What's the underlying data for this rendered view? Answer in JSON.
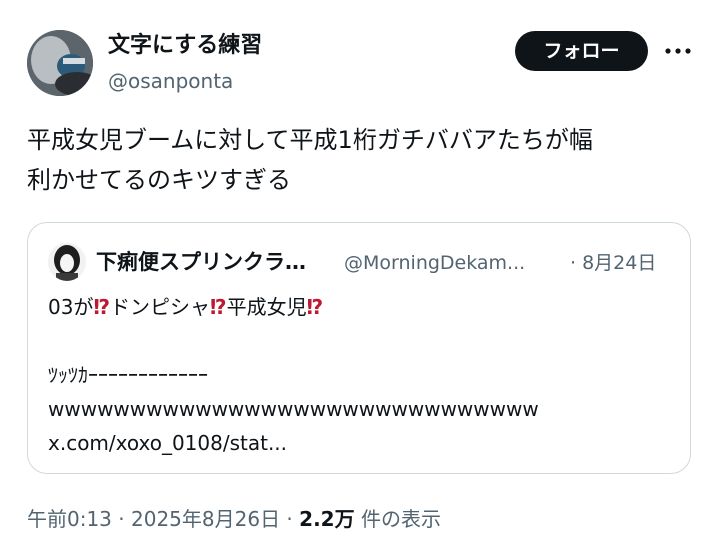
{
  "author": {
    "display_name": "文字にする練習",
    "handle": "@osanponta"
  },
  "header": {
    "follow_label": "フォロー",
    "more_icon": "more-dots-icon"
  },
  "tweet": {
    "text": "平成女児ブームに対して平成1桁ガチババアたちが幅\n利かせてるのキツすぎる"
  },
  "quote": {
    "display_name": "下痢便スプリンクラ…",
    "handle": "@MorningDekam...",
    "date": "· 8月24日",
    "line1_a": "03が",
    "line1_b": "ドンピシャ",
    "line1_c": "平成女児",
    "emoji": "⁉",
    "line2": "ﾂｯﾂｶｰｰｰｰｰｰｰｰｰｰｰｰ",
    "line3": "wwwwwwwwwwwwwwwwwwwwwwwwwwwwww",
    "link": "x.com/xoxo_0108/stat..."
  },
  "meta": {
    "time": "午前0:13",
    "sep1": " · ",
    "date": "2025年8月26日",
    "sep2": " · ",
    "views_count": "2.2万",
    "views_label": " 件の表示"
  },
  "colors": {
    "text": "#0f1419",
    "secondary": "#536471",
    "border": "#cfd9de",
    "emoji_red": "#be1931"
  }
}
